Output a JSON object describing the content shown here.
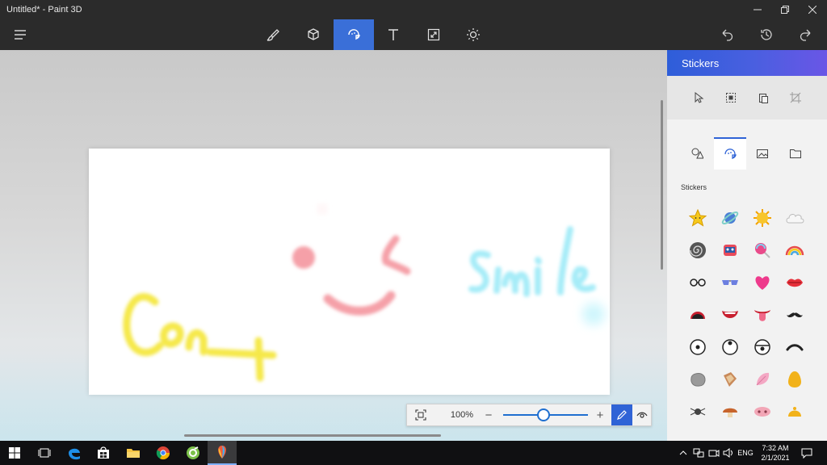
{
  "window": {
    "title": "Untitled* - Paint 3D",
    "minimize_icon": "minimize-icon",
    "maximize_icon": "restore-icon",
    "close_icon": "close-icon"
  },
  "commandbar": {
    "menu_icon": "hamburger-menu-icon",
    "tools": [
      {
        "name": "brushes",
        "icon": "brush-icon"
      },
      {
        "name": "3d-shapes",
        "icon": "cube-icon"
      },
      {
        "name": "stickers",
        "icon": "sticker-icon",
        "active": true
      },
      {
        "name": "text",
        "icon": "text-icon"
      },
      {
        "name": "canvas",
        "icon": "canvas-resize-icon"
      },
      {
        "name": "effects",
        "icon": "sun-icon"
      }
    ],
    "undo_icon": "undo-icon",
    "history_icon": "history-icon",
    "redo_icon": "redo-icon"
  },
  "canvas": {
    "drawing_text_1": "Smile",
    "drawing_text_2": "Con"
  },
  "zoom": {
    "value": "100%",
    "level_percent": 100,
    "minus": "−",
    "plus": "+"
  },
  "panel": {
    "title": "Stickers",
    "section_label": "Stickers",
    "tool_icons": [
      "select-icon",
      "select-all-icon",
      "paste-icon",
      "crop-icon"
    ],
    "tab_icons": [
      "shapes-icon",
      "sticker-face-icon",
      "image-icon",
      "folder-icon"
    ],
    "stickers": [
      "⭐",
      "🪐",
      "☀",
      "☁",
      "🌀",
      "🎁",
      "🍭",
      "🌈",
      "👓",
      "🕶",
      "💗",
      "👄",
      "👄",
      "👄",
      "👅",
      "🥸",
      "⊙",
      "◉",
      "◔",
      "⌒",
      "🪨",
      "🍫",
      "🪶",
      "🥚",
      "🕷",
      "🍄",
      "🐷",
      "🛎"
    ]
  },
  "taskbar": {
    "apps": [
      "windows-start-icon",
      "task-view-icon",
      "edge-icon",
      "store-icon",
      "file-explorer-icon",
      "chrome-icon",
      "greenshot-icon",
      "paint3d-icon"
    ],
    "tray_lang": "ENG",
    "time": "7:32 AM",
    "date": "2/1/2021"
  },
  "colors": {
    "accent": "#2f63d6",
    "titlebar": "#2b2b2b",
    "panel_head_start": "#2e5ed9",
    "panel_head_end": "#6a56e6",
    "drawing_yellow": "#f5e84a",
    "drawing_pink": "#f5a0a8",
    "drawing_cyan": "#a6ecf8"
  }
}
